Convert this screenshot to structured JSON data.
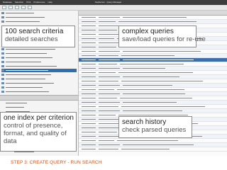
{
  "menubar": {
    "items": [
      "Database",
      "Selection",
      "Print",
      "Preferences",
      "Help"
    ],
    "app_title": "SeqServer · Query Manager"
  },
  "callouts": {
    "search_criteria": {
      "title": "100 search criteria",
      "subtitle": "detailed searches"
    },
    "complex_queries": {
      "title": "complex queries",
      "subtitle": "save/load queries for re-use"
    },
    "search_history": {
      "title": "search history",
      "subtitle": "check parsed queries"
    },
    "index_criterion": {
      "title": "one index per criterion",
      "subtitle": "control of presence, format, and quality of data"
    }
  },
  "footer": {
    "step_label": "STEP 3: CREATE QUERY - RUN SEARCH"
  },
  "colors": {
    "accent": "#c8541c",
    "selection": "#2f6fae"
  }
}
